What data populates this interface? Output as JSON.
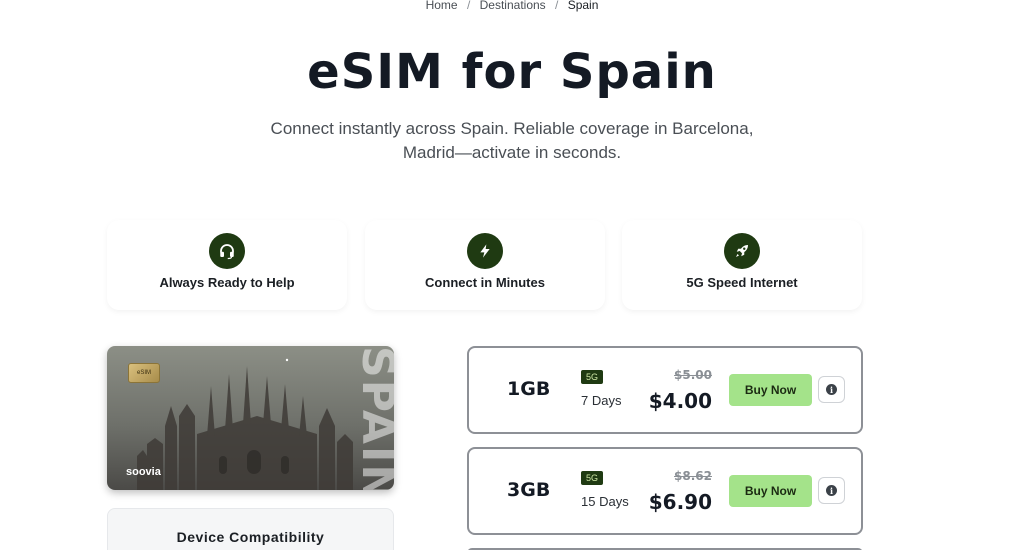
{
  "breadcrumb": {
    "items": [
      "Home",
      "Destinations",
      "Spain"
    ],
    "separator": "/"
  },
  "hero": {
    "title": "eSIM for Spain",
    "subtitle": "Connect instantly across Spain. Reliable coverage in Barcelona, Madrid—activate in seconds."
  },
  "features": [
    {
      "label": "Always Ready to Help",
      "icon": "headset-icon"
    },
    {
      "label": "Connect in Minutes",
      "icon": "lightning-icon"
    },
    {
      "label": "5G Speed Internet",
      "icon": "rocket-icon"
    }
  ],
  "card": {
    "chip_label": "eSIM",
    "brand": "soovia",
    "country_text": "SPAIN"
  },
  "compatibility": {
    "title": "Device Compatibility"
  },
  "plans": [
    {
      "data": "1GB",
      "network": "5G",
      "days": "7 Days",
      "old_price": "$5.00",
      "price": "$4.00",
      "button": "Buy Now"
    },
    {
      "data": "3GB",
      "network": "5G",
      "days": "15 Days",
      "old_price": "$8.62",
      "price": "$6.90",
      "button": "Buy Now"
    }
  ],
  "colors": {
    "accent_dark": "#1f3a12",
    "buy_button": "#a4e38a",
    "title": "#141a24"
  }
}
